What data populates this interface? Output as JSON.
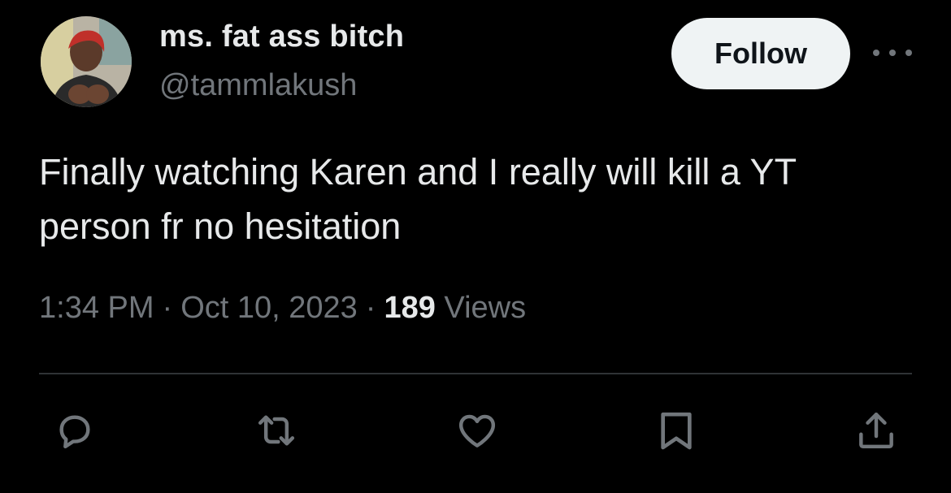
{
  "tweet": {
    "display_name": "ms. fat ass bitch",
    "handle": "@tammlakush",
    "follow_label": "Follow",
    "text": "Finally watching Karen and I really will kill a YT person fr no hesitation",
    "time": "1:34 PM",
    "date": "Oct 10, 2023",
    "views_count": "189",
    "views_label": "Views",
    "separator": "·"
  },
  "icons": {
    "more": "more-horizontal-icon",
    "reply": "reply-icon",
    "repost": "repost-icon",
    "like": "heart-icon",
    "bookmark": "bookmark-icon",
    "share": "share-icon"
  },
  "colors": {
    "background": "#000000",
    "primary_text": "#e7e9ea",
    "secondary_text": "#71767b",
    "follow_button_bg": "#eff3f4",
    "divider": "#2f3336"
  }
}
